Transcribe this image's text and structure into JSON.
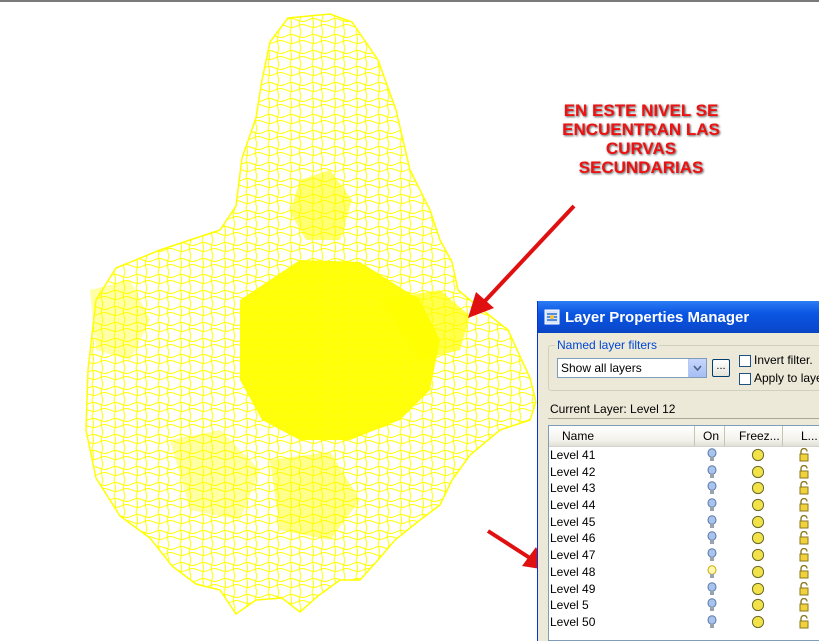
{
  "annotation": {
    "lines": [
      "EN ESTE NIVEL SE",
      "ENCUENTRAN LAS",
      "CURVAS",
      "SECUNDARIAS"
    ],
    "color": "#ee1111"
  },
  "drawing": {
    "contour_color": "#ffff00"
  },
  "dialog": {
    "title": "Layer Properties Manager",
    "title_icon": "layer-manager-icon",
    "filters_group_label": "Named layer filters",
    "filter_value": "Show all layers",
    "dots_label": "...",
    "invert_filter_label": "Invert filter.",
    "apply_to_layers_label": "Apply to layers",
    "current_layer_label": "Current Layer:",
    "current_layer_value": "Level 12",
    "columns": {
      "name": "Name",
      "on": "On",
      "freeze": "Freez...",
      "lock": "L..."
    },
    "rows": [
      {
        "name": "Level 41",
        "on": true
      },
      {
        "name": "Level 42",
        "on": true
      },
      {
        "name": "Level 43",
        "on": true
      },
      {
        "name": "Level 44",
        "on": true
      },
      {
        "name": "Level 45",
        "on": true
      },
      {
        "name": "Level 46",
        "on": true
      },
      {
        "name": "Level 47",
        "on": true
      },
      {
        "name": "Level 48",
        "on": true,
        "highlighted": true
      },
      {
        "name": "Level 49",
        "on": true
      },
      {
        "name": "Level 5",
        "on": true
      },
      {
        "name": "Level 50",
        "on": true
      }
    ]
  },
  "colors": {
    "arrow": "#e01010",
    "titlebar": "#0a55e2",
    "dialog_bg": "#ece9d8"
  }
}
